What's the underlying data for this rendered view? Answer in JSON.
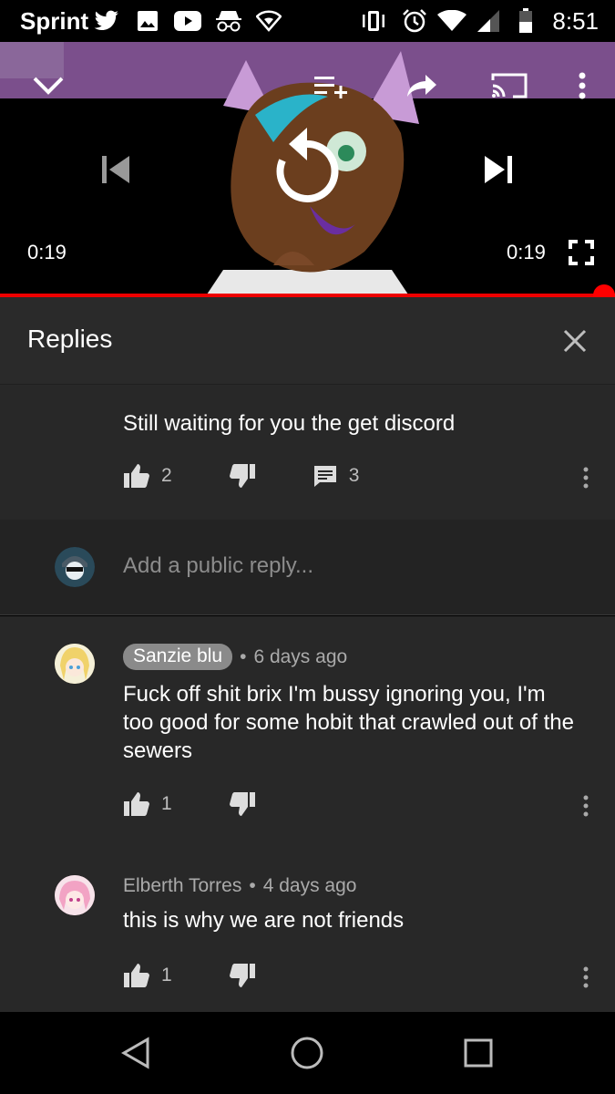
{
  "status_bar": {
    "carrier": "Sprint",
    "time": "8:51",
    "icons": [
      "twitter-icon",
      "image-icon",
      "youtube-icon",
      "incognito-icon",
      "wifi-outline-icon",
      "vibrate-icon",
      "alarm-icon",
      "wifi-icon",
      "signal-icon",
      "battery-icon"
    ]
  },
  "player": {
    "time_elapsed": "0:19",
    "time_total": "0:19",
    "progress": 1.0,
    "icons": [
      "collapse-chevron-icon",
      "add-to-queue-icon",
      "share-icon",
      "cast-icon",
      "more-vert-icon",
      "previous-icon",
      "replay-icon",
      "next-icon",
      "fullscreen-icon"
    ]
  },
  "replies_panel": {
    "title": "Replies"
  },
  "parent_comment": {
    "text": "Still waiting for you the get discord",
    "likes": "2",
    "replies": "3"
  },
  "reply_input": {
    "placeholder": "Add a public reply..."
  },
  "replies": [
    {
      "author": "Sanzie blu",
      "time": "6 days ago",
      "text": "Fuck off shit brix I'm bussy ignoring you, I'm too good for some hobit that crawled out of the sewers",
      "likes": "1"
    },
    {
      "author": "Elberth Torres",
      "time": "4 days ago",
      "text": "this is why we are not friends",
      "likes": "1"
    }
  ],
  "colors": {
    "accent": "#ff0000",
    "panel": "#282828",
    "author_chip": "#8a8a8a"
  }
}
